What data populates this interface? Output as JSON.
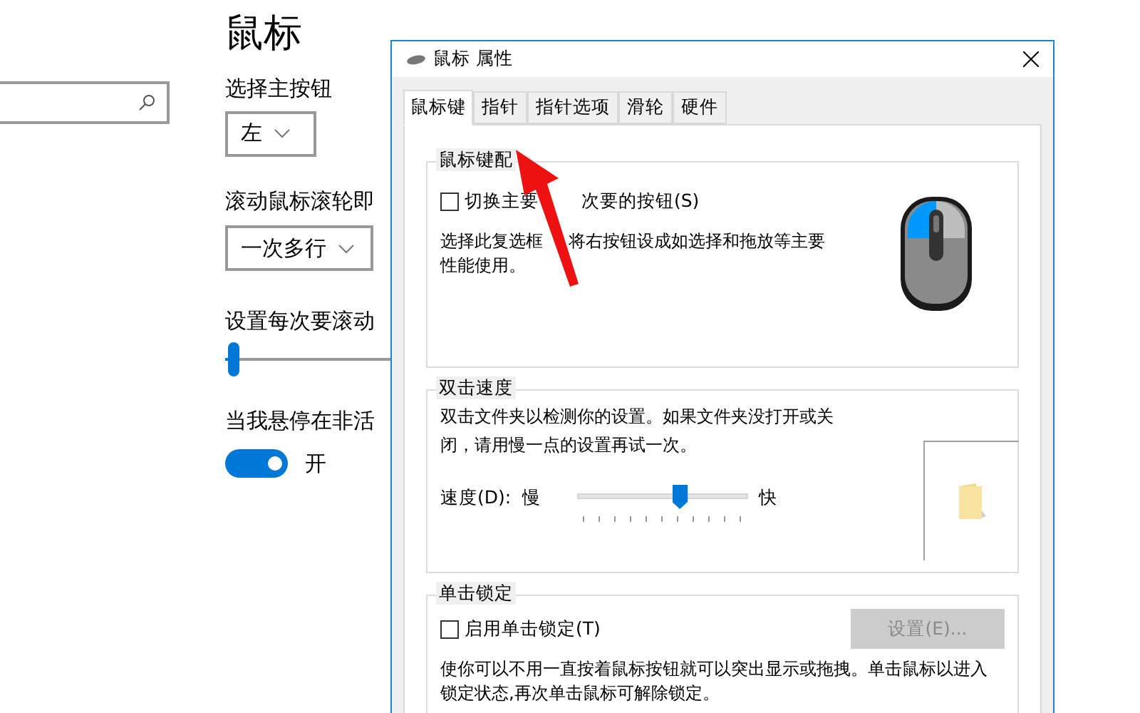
{
  "settings_page": {
    "title": "鼠标",
    "primary_button": {
      "label": "选择主按钮",
      "value": "左"
    },
    "scroll": {
      "label": "滚动鼠标滚轮即",
      "value": "一次多行"
    },
    "lines": {
      "label": "设置每次要滚动",
      "level": 0.05
    },
    "inactive": {
      "label": "当我悬停在非活",
      "on": true,
      "state": "开"
    }
  },
  "dialog": {
    "title": "鼠标 属性",
    "tabs": [
      {
        "label": "鼠标键",
        "selected": true
      },
      {
        "label": "指针",
        "selected": false
      },
      {
        "label": "指针选项",
        "selected": false
      },
      {
        "label": "滑轮",
        "selected": false
      },
      {
        "label": "硬件",
        "selected": false
      }
    ],
    "button_config": {
      "title": "鼠标键配",
      "checkbox": {
        "label_parts": [
          "切换主要",
          "次要的按钮(S)"
        ],
        "checked": false
      },
      "description_parts": [
        "选择此复选框",
        "将右按钮设成如选择和拖放等主要",
        "性能使用。"
      ]
    },
    "double_click": {
      "title": "双击速度",
      "description": "双击文件夹以检测你的设置。如果文件夹没打开或关闭，请用慢一点的设置再试一次。",
      "speed_label": "速度(D):",
      "slow": "慢",
      "fast": "快",
      "level": 0.6
    },
    "click_lock": {
      "title": "单击锁定",
      "checkbox": {
        "label": "启用单击锁定(T)",
        "checked": false
      },
      "settings_button": {
        "label": "设置(E)...",
        "disabled": true
      },
      "description": "使你可以不用一直按着鼠标按钮就可以突出显示或拖拽。单击鼠标以进入锁定状态,再次单击鼠标可解除锁定。"
    }
  },
  "annotation": {
    "kind": "arrow"
  }
}
